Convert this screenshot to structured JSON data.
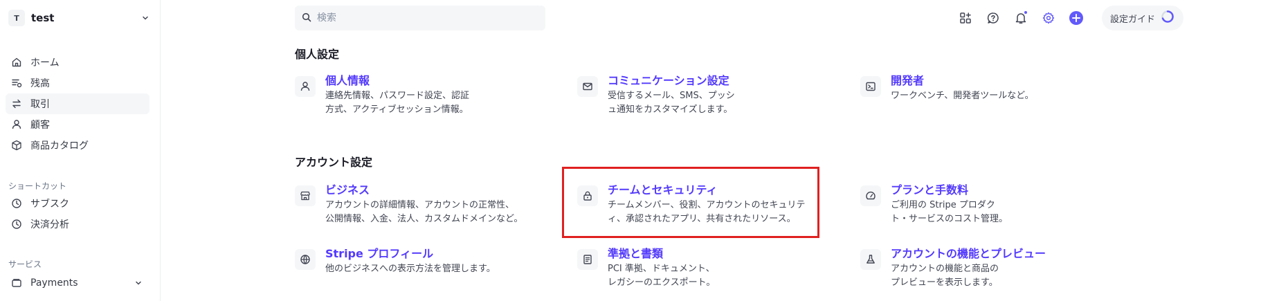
{
  "account": {
    "initial": "T",
    "name": "test"
  },
  "sidebar": {
    "main": [
      {
        "label": "ホーム",
        "icon": "home-icon"
      },
      {
        "label": "残高",
        "icon": "balance-icon"
      },
      {
        "label": "取引",
        "icon": "transactions-icon",
        "active": true
      },
      {
        "label": "顧客",
        "icon": "customer-icon"
      },
      {
        "label": "商品カタログ",
        "icon": "product-catalog-icon"
      }
    ],
    "shortcuts_title": "ショートカット",
    "shortcuts": [
      {
        "label": "サブスク",
        "icon": "clock-icon"
      },
      {
        "label": "決済分析",
        "icon": "clock-icon"
      }
    ],
    "services_title": "サービス",
    "services": [
      {
        "label": "Payments",
        "icon": "wallet-icon"
      }
    ]
  },
  "search": {
    "placeholder": "検索"
  },
  "topbar": {
    "setup_guide": "設定ガイド",
    "accent": "#625afa"
  },
  "personal": {
    "title": "個人設定",
    "cards": [
      {
        "title": "個人情報",
        "desc1": "連絡先情報、パスワード設定、認証",
        "desc2": "方式、アクティブセッション情報。",
        "icon": "user-icon"
      },
      {
        "title": "コミュニケーション設定",
        "desc1": "受信するメール、SMS、プッシ",
        "desc2": "ュ通知をカスタマイズします。",
        "icon": "mail-icon"
      },
      {
        "title": "開発者",
        "desc1": "ワークベンチ、開発者ツールなど。",
        "desc2": "",
        "icon": "terminal-icon"
      }
    ]
  },
  "account_settings": {
    "title": "アカウント設定",
    "cards": [
      {
        "title": "ビジネス",
        "desc1": "アカウントの詳細情報、アカウントの正常性、",
        "desc2": "公開情報、入金、法人、カスタムドメインなど。",
        "icon": "store-icon"
      },
      {
        "title": "チームとセキュリティ",
        "desc1": "チームメンバー、役割、アカウントのセキュリテ",
        "desc2": "ィ、承認されたアプリ、共有されたリソース。",
        "icon": "lock-icon"
      },
      {
        "title": "プランと手数料",
        "desc1": "ご利用の Stripe プロダク",
        "desc2": "ト・サービスのコスト管理。",
        "icon": "gauge-icon"
      },
      {
        "title": "Stripe プロフィール",
        "desc1": "他のビジネスへの表示方法を管理します。",
        "desc2": "",
        "icon": "globe-icon"
      },
      {
        "title": "準拠と書類",
        "desc1": "PCI 準拠、ドキュメント、",
        "desc2": "レガシーのエクスポート。",
        "icon": "document-icon"
      },
      {
        "title": "アカウントの機能とプレビュー",
        "desc1": "アカウントの機能と商品の",
        "desc2": "プレビューを表示します。",
        "icon": "flask-icon"
      }
    ]
  }
}
